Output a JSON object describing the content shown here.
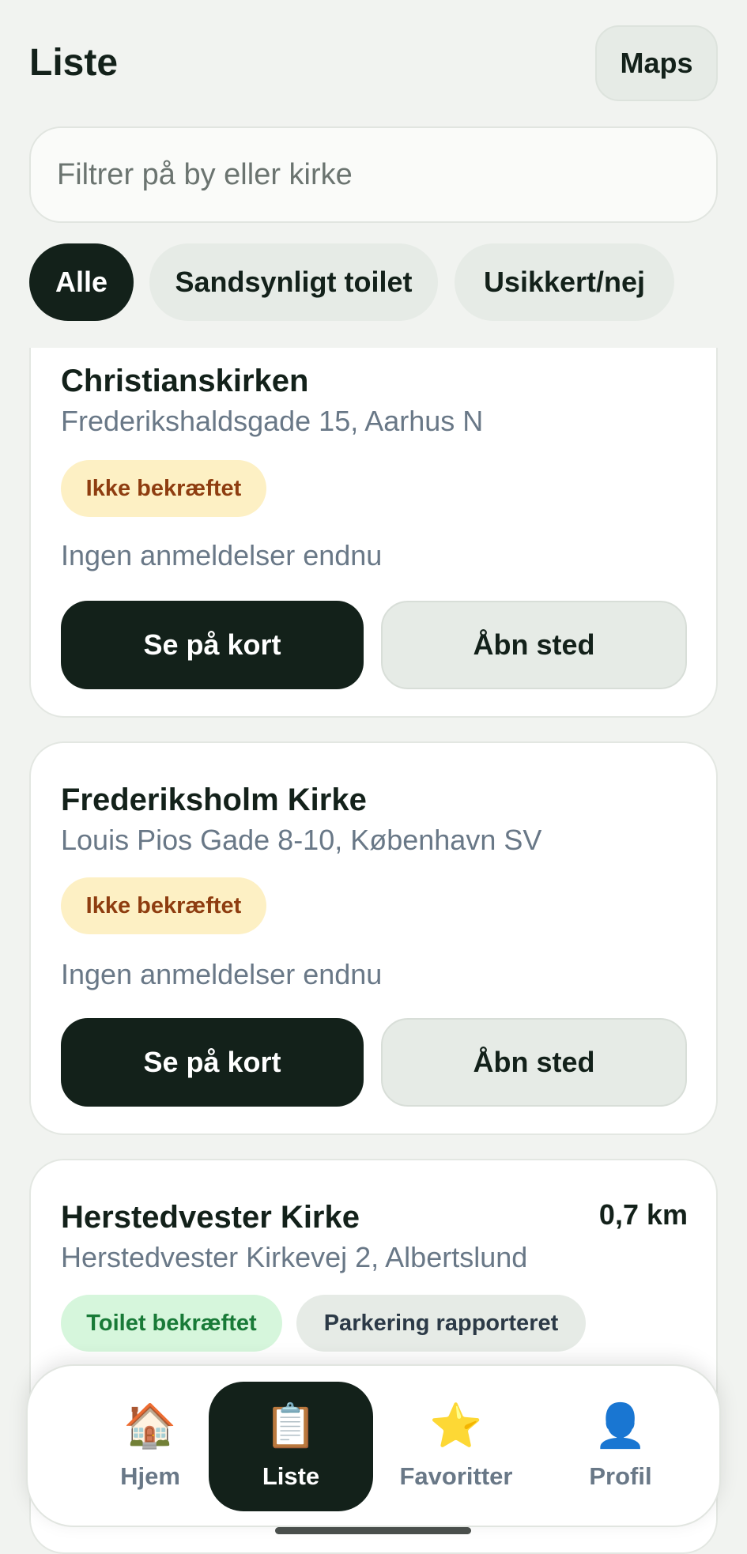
{
  "header": {
    "title": "Liste",
    "maps_label": "Maps"
  },
  "search": {
    "placeholder": "Filtrer på by eller kirke",
    "value": ""
  },
  "filters": [
    {
      "label": "Alle",
      "active": true
    },
    {
      "label": "Sandsynligt toilet",
      "active": false
    },
    {
      "label": "Usikkert/nej",
      "active": false
    }
  ],
  "cards": [
    {
      "name": "Christianskirken",
      "address": "Frederikshaldsgade 15, Aarhus N",
      "badges": [
        {
          "label": "Ikke bekræftet",
          "kind": "warn"
        }
      ],
      "reviews": "Ingen anmeldelser endnu",
      "primary_button": "Se på kort",
      "secondary_button": "Åbn sted"
    },
    {
      "name": "Frederiksholm Kirke",
      "address": "Louis Pios Gade 8-10, København SV",
      "badges": [
        {
          "label": "Ikke bekræftet",
          "kind": "warn"
        }
      ],
      "reviews": "Ingen anmeldelser endnu",
      "primary_button": "Se på kort",
      "secondary_button": "Åbn sted"
    },
    {
      "name": "Herstedvester Kirke",
      "distance": "0,7 km",
      "address": "Herstedvester Kirkevej 2, Albertslund",
      "badges": [
        {
          "label": "Toilet bekræftet",
          "kind": "ok"
        },
        {
          "label": "Parkering rapporteret",
          "kind": "neutral"
        }
      ]
    }
  ],
  "nav": [
    {
      "label": "Hjem",
      "icon": "house-icon",
      "glyph": "🏠",
      "active": false
    },
    {
      "label": "Liste",
      "icon": "clipboard-icon",
      "glyph": "📋",
      "active": true
    },
    {
      "label": "Favoritter",
      "icon": "star-icon",
      "glyph": "⭐",
      "active": false
    },
    {
      "label": "Profil",
      "icon": "user-icon",
      "glyph": "👤",
      "active": false
    }
  ],
  "colors": {
    "accent_dark": "#13211a",
    "background": "#f1f3f0",
    "warn_bg": "#fdf0c4",
    "warn_text": "#8e3d10",
    "ok_bg": "#d6f6dc",
    "ok_text": "#187a37"
  }
}
